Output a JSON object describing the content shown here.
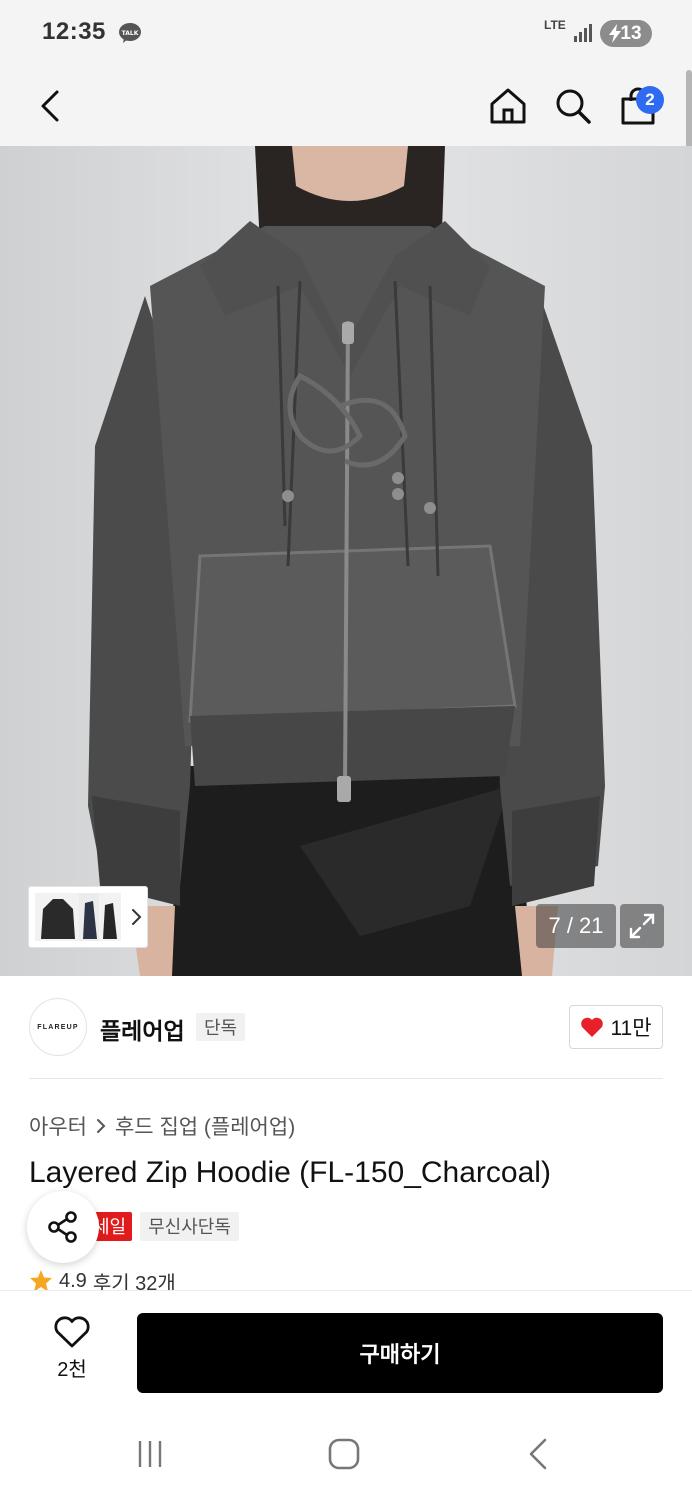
{
  "status_bar": {
    "time": "12:35",
    "network": "LTE",
    "battery": "13"
  },
  "header": {
    "cart_badge": "2"
  },
  "gallery": {
    "counter": "7 / 21"
  },
  "brand": {
    "logo_text": "FLAREUP",
    "name": "플레어업",
    "exclusive_tag": "단독",
    "likes": "11만"
  },
  "product": {
    "breadcrumb": [
      "아우터",
      "후드 집업 (플레어업)"
    ],
    "title": "Layered Zip Hoodie (FL-150_Charcoal)",
    "sale_tag": "세일",
    "musinsa_tag": "무신사단독",
    "rating": "4.9",
    "review_text": "후기 32개"
  },
  "action_bar": {
    "wish_count": "2천",
    "buy_label": "구매하기"
  },
  "colors": {
    "accent_blue": "#2f6bf2",
    "sale_red": "#e11b1b",
    "heart_red": "#e8202a",
    "star_orange": "#f5a623",
    "buy_black": "#000000"
  },
  "icons": [
    "kakaotalk-icon",
    "signal-icon",
    "battery-icon",
    "back-arrow-icon",
    "home-icon",
    "search-icon",
    "shopping-bag-icon",
    "chevron-right-icon",
    "expand-icon",
    "heart-icon",
    "share-icon",
    "star-icon",
    "recent-apps-icon",
    "home-nav-icon",
    "back-nav-icon"
  ]
}
